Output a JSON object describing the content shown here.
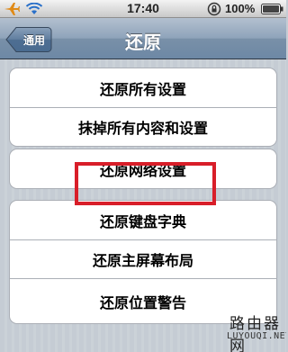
{
  "status_bar": {
    "time": "17:40",
    "battery_percent": "100%",
    "icons": [
      "airplane-icon",
      "wifi-icon",
      "rotation-lock-icon",
      "battery-icon"
    ]
  },
  "nav": {
    "back_label": "通用",
    "title": "还原"
  },
  "groups": [
    {
      "items": [
        {
          "label": "还原所有设置"
        },
        {
          "label": "抹掉所有内容和设置"
        }
      ]
    },
    {
      "items": [
        {
          "label": "还原网络设置"
        }
      ]
    },
    {
      "items": [
        {
          "label": "还原键盘字典"
        },
        {
          "label": "还原主屏幕布局"
        },
        {
          "label": "还原位置警告"
        }
      ]
    }
  ],
  "highlight": {
    "target": "还原网络设置",
    "color": "#d81e29"
  },
  "watermark": {
    "text_cn": "路由器网",
    "text_en": "LUYOUQI.NET"
  },
  "colors": {
    "nav_bar": "#6d88a5",
    "background": "#c5ccd4"
  }
}
